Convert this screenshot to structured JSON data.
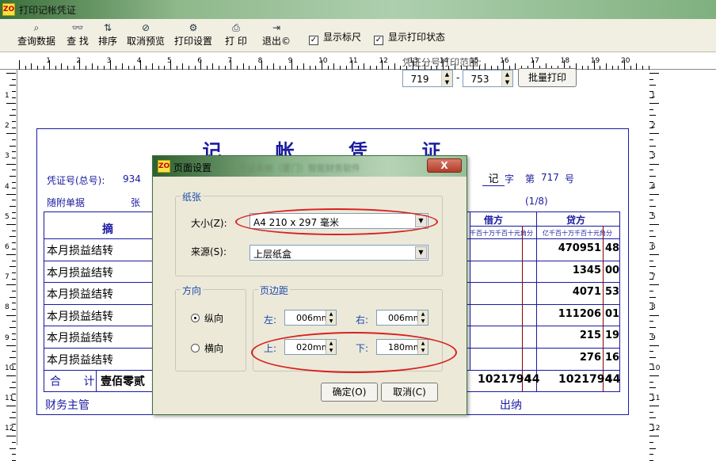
{
  "window": {
    "title": "打印记帐凭证"
  },
  "toolbar": {
    "buttons": [
      {
        "label": "查询数据",
        "icon": "search-icon"
      },
      {
        "label": "查 找",
        "icon": "binoculars-icon"
      },
      {
        "label": "排序",
        "icon": "sort-icon"
      },
      {
        "label": "取消预览",
        "icon": "cancel-preview-icon"
      },
      {
        "label": "打印设置",
        "icon": "print-settings-icon"
      },
      {
        "label": "打 印",
        "icon": "printer-icon"
      },
      {
        "label": "退出©",
        "icon": "exit-icon"
      }
    ],
    "checkboxes": [
      {
        "label": "显示标尺",
        "checked": true
      },
      {
        "label": "显示打印状态",
        "checked": true
      }
    ]
  },
  "ruler": {
    "h_numbers": [
      "1",
      "2",
      "3",
      "4",
      "5",
      "6",
      "7",
      "8",
      "9",
      "10",
      "11",
      "12",
      "13",
      "14",
      "15",
      "16",
      "17",
      "18",
      "19",
      "20"
    ],
    "v_numbers": [
      "1",
      "2",
      "3",
      "4",
      "5",
      "6",
      "7",
      "8",
      "9",
      "10",
      "11",
      "12"
    ]
  },
  "print_range": {
    "label": "凭证分号打印范围:",
    "from": "719",
    "to": "753",
    "dash": "-",
    "batch_button": "批量打印"
  },
  "voucher": {
    "title": "记 帐 凭 证",
    "number_label": "凭证号(总号):",
    "number_value": "934",
    "attach_label": "随附单据",
    "attach_unit": "张",
    "ji_char": "记",
    "zi_label": "字",
    "di_label": "第",
    "di_number": "717",
    "hao_label": "号",
    "page": "(1/8)",
    "summary_header": "摘 要",
    "debit_header": "借方",
    "credit_header": "贷方",
    "digit_header_debit": "千百十万千百十元角分",
    "digit_header_credit": "亿千百十万千百十元角分",
    "rows": [
      {
        "summary": "本月损益结转",
        "credit_int": "470951",
        "credit_dec": "48"
      },
      {
        "summary": "本月损益结转",
        "credit_int": "1345",
        "credit_dec": "00"
      },
      {
        "summary": "本月损益结转",
        "credit_int": "4071",
        "credit_dec": "53"
      },
      {
        "summary": "本月损益结转",
        "credit_int": "111206",
        "credit_dec": "01"
      },
      {
        "summary": "本月损益结转",
        "credit_int": "215",
        "credit_dec": "19"
      },
      {
        "summary": "本月损益结转",
        "credit_int": "276",
        "credit_dec": "16"
      }
    ],
    "total_label": "合 计",
    "total_words": "壹佰零贰",
    "total_debit_int": "1021794",
    "total_debit_dec": "44",
    "total_credit_int": "1021794",
    "total_credit_dec": "44",
    "finance_label": "财务主管",
    "cashier_label": "出纳"
  },
  "dialog": {
    "title": "页面设置",
    "title_obscured": "凭证系统（厦门）智能财务软件",
    "paper_group": "纸张",
    "size_label": "大小(Z):",
    "size_value": "A4 210 x 297 毫米",
    "source_label": "来源(S):",
    "source_value": "上层纸盒",
    "orientation_group": "方向",
    "portrait_label": "纵向",
    "landscape_label": "横向",
    "orientation_selected": "纵向",
    "margins_group": "页边距",
    "left_label": "左:",
    "left_value": "006mm",
    "right_label": "右:",
    "right_value": "006mm",
    "top_label": "上:",
    "top_value": "020mm",
    "bottom_label": "下:",
    "bottom_value": "180mm",
    "ok_button": "确定(O)",
    "cancel_button": "取消(C)",
    "close_glyph": "X"
  },
  "colors": {
    "voucher_blue": "#1a1aa0",
    "highlight_red": "#d82020",
    "title_green": "#3a6f3a"
  }
}
